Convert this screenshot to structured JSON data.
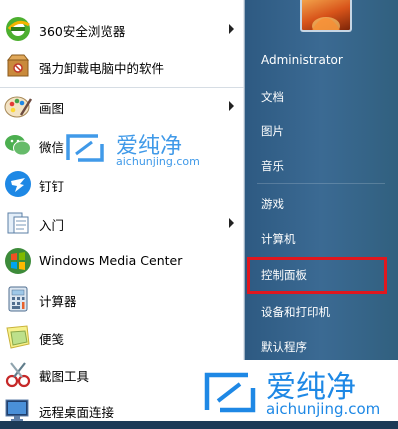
{
  "programs": [
    {
      "label": "360安全浏览器",
      "icon": "360-browser-icon",
      "has_submenu": true
    },
    {
      "label": "强力卸载电脑中的软件",
      "icon": "uninstall-box-icon",
      "has_submenu": false
    },
    {
      "label": "画图",
      "icon": "paint-palette-icon",
      "has_submenu": true
    },
    {
      "label": "微信",
      "icon": "wechat-icon",
      "has_submenu": false
    },
    {
      "label": "钉钉",
      "icon": "dingtalk-icon",
      "has_submenu": false
    },
    {
      "label": "入门",
      "icon": "getting-started-icon",
      "has_submenu": true
    },
    {
      "label": "Windows Media Center",
      "icon": "windows-media-center-icon",
      "has_submenu": false
    },
    {
      "label": "计算器",
      "icon": "calculator-icon",
      "has_submenu": false
    },
    {
      "label": "便笺",
      "icon": "sticky-notes-icon",
      "has_submenu": false
    },
    {
      "label": "截图工具",
      "icon": "snipping-tool-icon",
      "has_submenu": false
    },
    {
      "label": "远程桌面连接",
      "icon": "remote-desktop-icon",
      "has_submenu": false
    }
  ],
  "right_menu": {
    "user": "Administrator",
    "items": [
      "文档",
      "图片",
      "音乐",
      "游戏",
      "计算机",
      "控制面板",
      "设备和打印机",
      "默认程序"
    ]
  },
  "watermark": {
    "cn": "爱纯净",
    "url": "aichunjing.com"
  },
  "colors": {
    "highlight": "#e0171e",
    "right_pane": "#3b6a93",
    "watermark_blue": "#1e88e5"
  }
}
